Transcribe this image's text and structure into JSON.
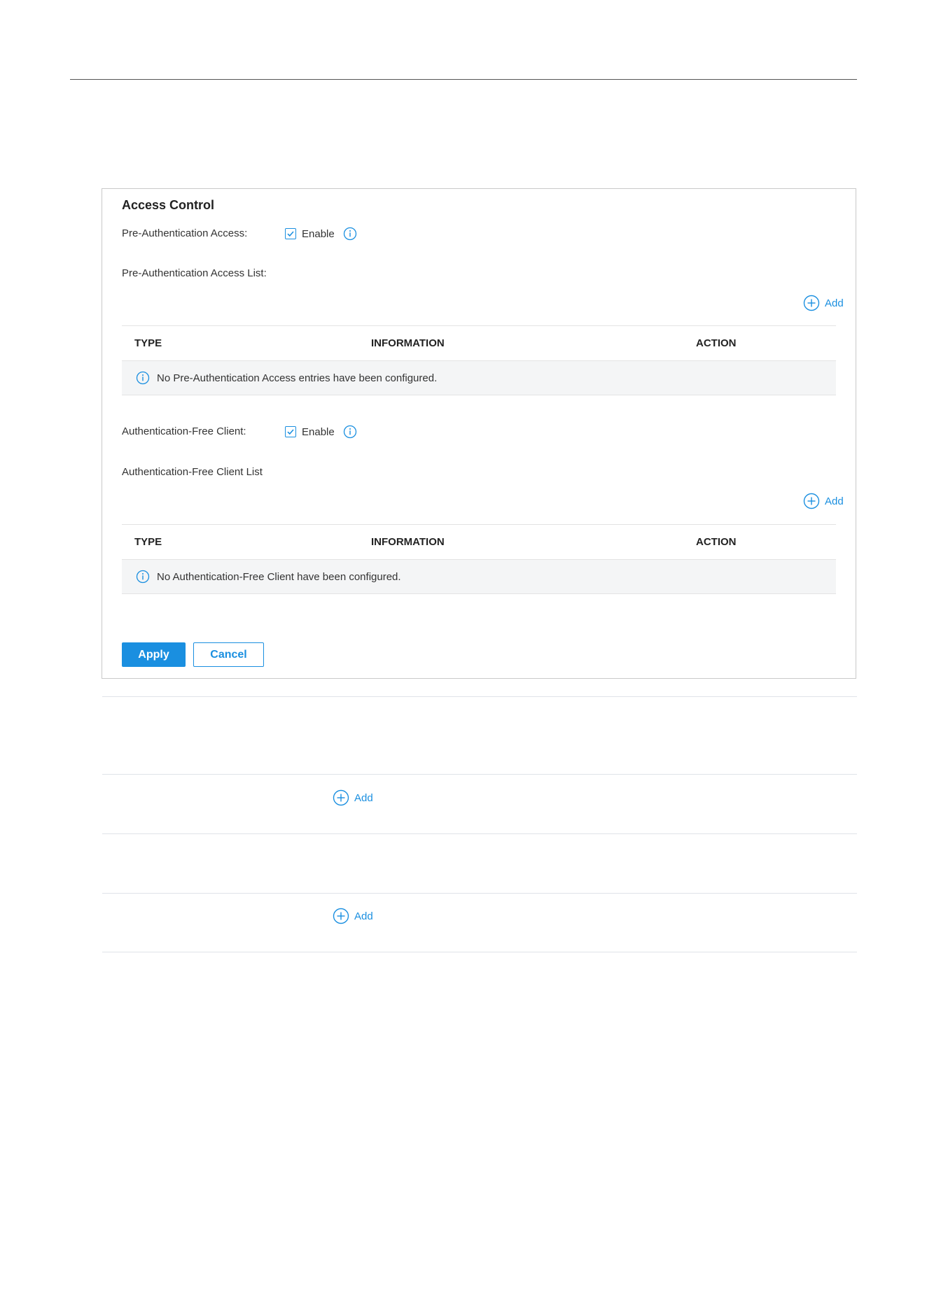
{
  "panel": {
    "title": "Access Control",
    "pre_auth": {
      "label": "Pre-Authentication Access:",
      "enable_label": "Enable",
      "checked": true,
      "list_label": "Pre-Authentication Access List:",
      "add_label": "Add",
      "columns": [
        "TYPE",
        "INFORMATION",
        "ACTION"
      ],
      "empty_message": "No Pre-Authentication Access entries have been configured."
    },
    "auth_free": {
      "label": "Authentication-Free Client:",
      "enable_label": "Enable",
      "checked": true,
      "list_label": "Authentication-Free Client List",
      "add_label": "Add",
      "columns": [
        "TYPE",
        "INFORMATION",
        "ACTION"
      ],
      "empty_message": "No Authentication-Free Client have been configured."
    },
    "apply_label": "Apply",
    "cancel_label": "Cancel"
  },
  "lower": {
    "add_1": "Add",
    "add_2": "Add"
  },
  "colors": {
    "accent": "#1a8fe0",
    "row_bg": "#f4f5f6"
  },
  "icons": [
    "check-icon",
    "info-icon",
    "add-circle-icon"
  ]
}
